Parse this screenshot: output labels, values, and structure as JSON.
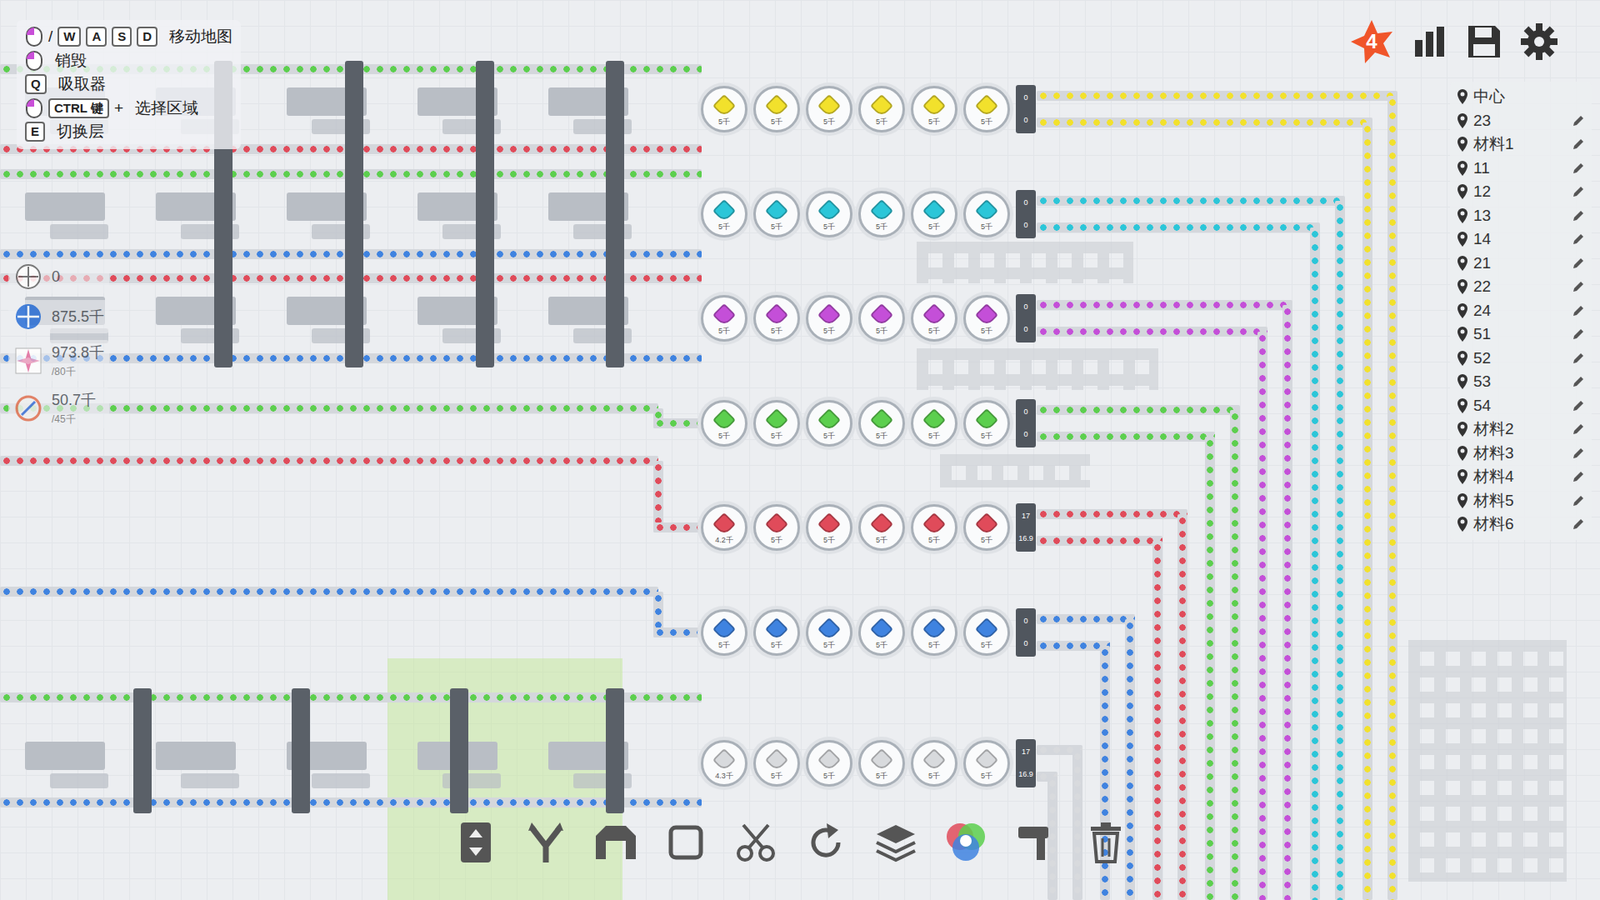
{
  "hints": [
    {
      "mouse": true,
      "separator": "/",
      "keys": [
        "W",
        "A",
        "S",
        "D"
      ],
      "label": "移动地图"
    },
    {
      "mouse": true,
      "keys": [],
      "label": "销毁"
    },
    {
      "mouse": false,
      "keys": [
        "Q"
      ],
      "label": "吸取器"
    },
    {
      "mouse": true,
      "keys": [
        "CTRL 键"
      ],
      "joiner": "+",
      "label": "选择区域"
    },
    {
      "mouse": false,
      "keys": [
        "E"
      ],
      "label": "切换层"
    }
  ],
  "stats": [
    {
      "value": "0"
    },
    {
      "value": "875.5千"
    },
    {
      "value": "973.8千",
      "limit": "/80千"
    },
    {
      "value": "50.7千",
      "limit": "/45千"
    }
  ],
  "top_bar": {
    "star_badge": "4"
  },
  "waypoints": [
    "中心",
    "23",
    "材料1",
    "11",
    "12",
    "13",
    "14",
    "21",
    "22",
    "24",
    "51",
    "52",
    "53",
    "54",
    "材料2",
    "材料3",
    "材料4",
    "材料5",
    "材料6"
  ],
  "rows": [
    {
      "color": "#f2e12c",
      "inputs": [
        "#5ccf4e",
        "#e04b5a"
      ],
      "machines": [
        "5千",
        "5千",
        "5千",
        "5千",
        "5千",
        "5千"
      ],
      "counters": [
        "0",
        "0"
      ]
    },
    {
      "color": "#2bc6d8",
      "inputs": [
        "#5ccf4e",
        "#3f83e0"
      ],
      "machines": [
        "5千",
        "5千",
        "5千",
        "5千",
        "5千",
        "5千"
      ],
      "counters": [
        "0",
        "0"
      ]
    },
    {
      "color": "#c44fd8",
      "inputs": [
        "#e04b5a",
        "#3f83e0"
      ],
      "machines": [
        "5千",
        "5千",
        "5千",
        "5千",
        "5千",
        "5千"
      ],
      "counters": [
        "0",
        "0"
      ]
    },
    {
      "color": "#5ccf4e",
      "inputs": [
        "#5ccf4e"
      ],
      "machines": [
        "5千",
        "5千",
        "5千",
        "5千",
        "5千",
        "5千"
      ],
      "counters": [
        "0",
        "0"
      ]
    },
    {
      "color": "#e04b5a",
      "inputs": [
        "#e04b5a"
      ],
      "machines": [
        "4.2千",
        "5千",
        "5千",
        "5千",
        "5千",
        "5千"
      ],
      "counters": [
        "17",
        "16.9"
      ]
    },
    {
      "color": "#3f83e0",
      "inputs": [
        "#3f83e0"
      ],
      "machines": [
        "5千",
        "5千",
        "5千",
        "5千",
        "5千",
        "5千"
      ],
      "counters": [
        "0",
        "0"
      ]
    },
    {
      "color": "#d8dadd",
      "inputs": [
        "#5ccf4e",
        "#3f83e0"
      ],
      "machines": [
        "4.3千",
        "5千",
        "5千",
        "5千",
        "5千",
        "5千"
      ],
      "counters": [
        "17",
        "16.9"
      ]
    }
  ]
}
